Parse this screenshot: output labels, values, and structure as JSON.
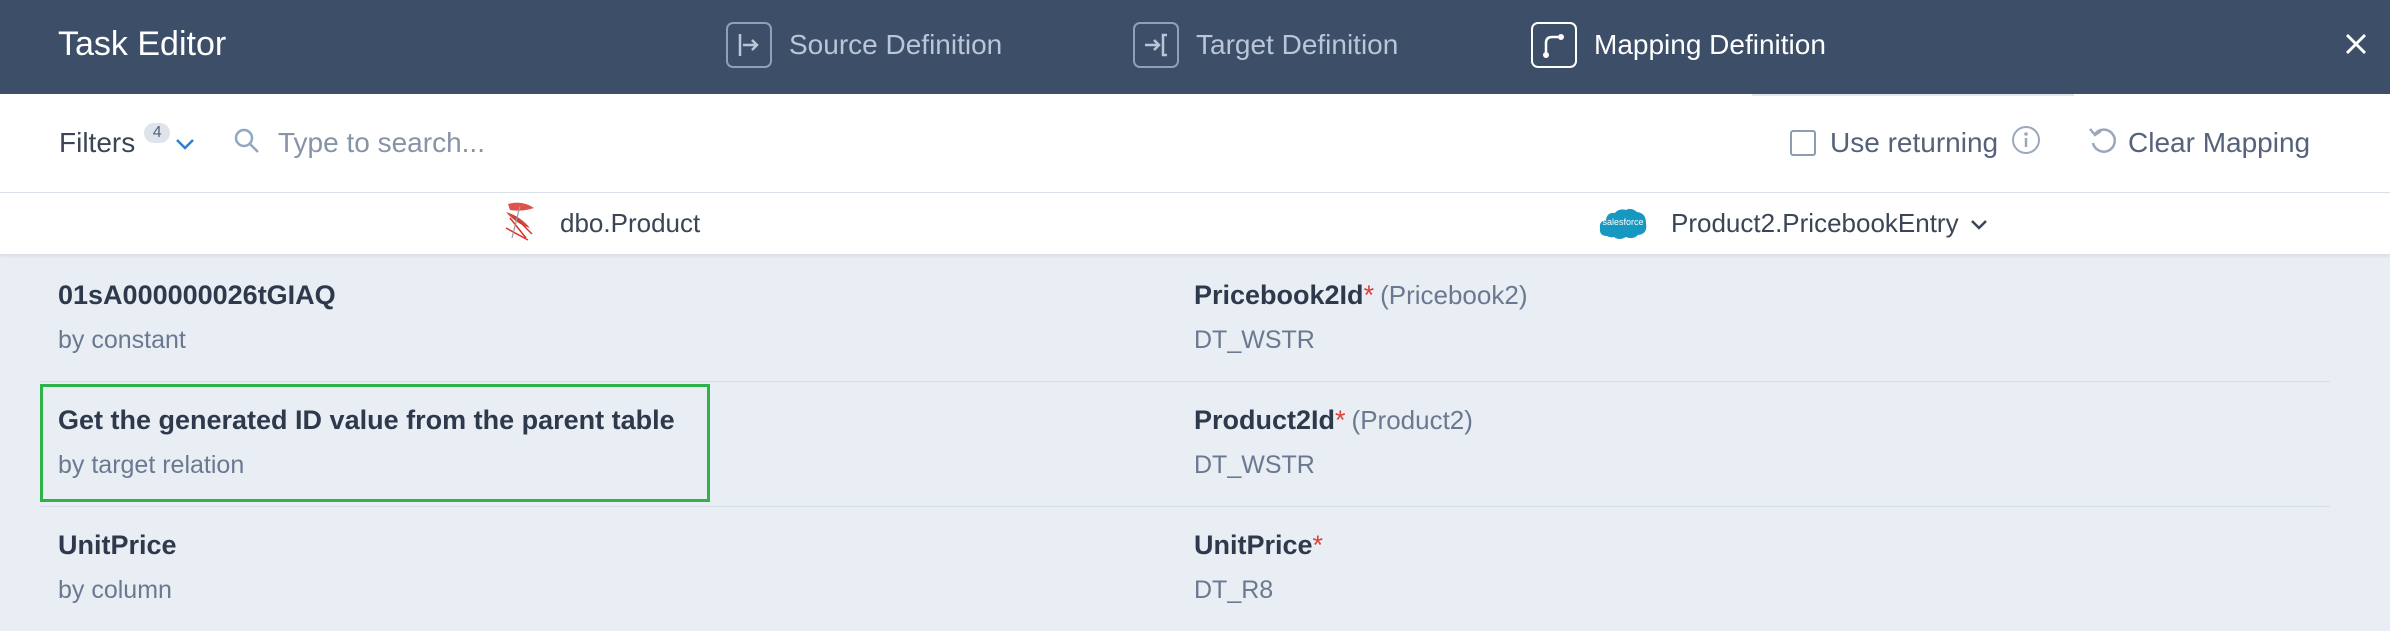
{
  "header": {
    "title": "Task Editor",
    "tabs": [
      {
        "label": "Source Definition",
        "icon": "source-definition-icon",
        "active": false
      },
      {
        "label": "Target Definition",
        "icon": "target-definition-icon",
        "active": false
      },
      {
        "label": "Mapping Definition",
        "icon": "mapping-definition-icon",
        "active": true
      }
    ],
    "close_icon": "close-icon"
  },
  "toolbar": {
    "filters_label": "Filters",
    "filters_count": "4",
    "search_placeholder": "Type to search...",
    "search_value": "",
    "use_returning_label": "Use returning",
    "use_returning_checked": false,
    "clear_mapping_label": "Clear Mapping"
  },
  "objects": {
    "source": "dbo.Product",
    "target": "Product2.PricebookEntry",
    "salesforce_logo_text": "salesforce"
  },
  "mappings": [
    {
      "source_name": "01sA000000026tGIAQ",
      "source_type": "by constant",
      "target_name": "Pricebook2Id",
      "target_required": "*",
      "target_ref": "(Pricebook2)",
      "target_type": "DT_WSTR"
    },
    {
      "source_name": "Get the generated ID value from the parent table",
      "source_type": "by target relation",
      "target_name": "Product2Id",
      "target_required": "*",
      "target_ref": "(Product2)",
      "target_type": "DT_WSTR"
    },
    {
      "source_name": "UnitPrice",
      "source_type": "by column",
      "target_name": "UnitPrice",
      "target_required": "*",
      "target_ref": "",
      "target_type": "DT_R8"
    }
  ],
  "colors": {
    "header_bg": "#3d4e68",
    "highlight": "#2db34a",
    "required": "#e0403a",
    "salesforce": "#1798c1"
  }
}
